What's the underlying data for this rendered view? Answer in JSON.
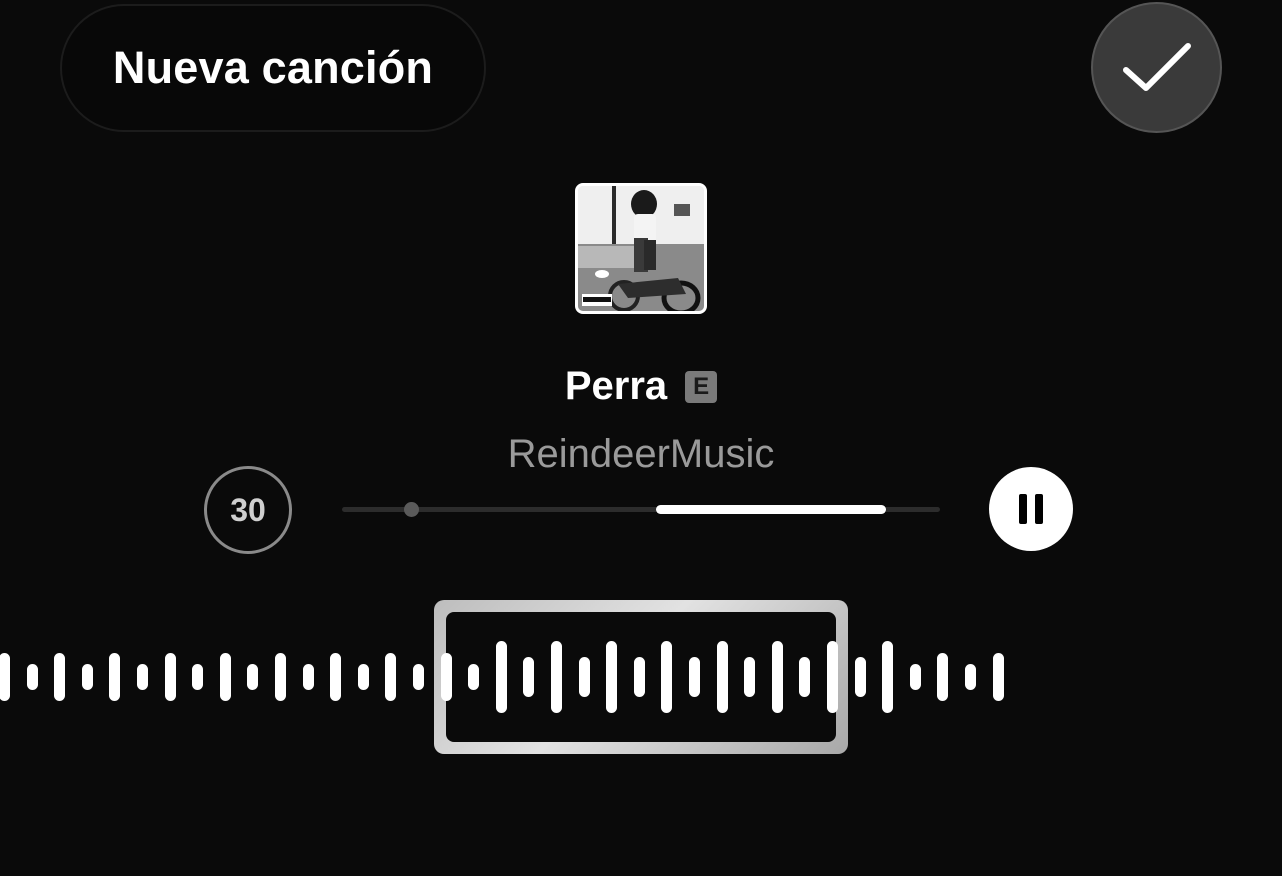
{
  "header": {
    "title_button_label": "Nueva canción",
    "confirm_icon": "checkmark-icon"
  },
  "track": {
    "artwork_icon": "album-cover",
    "title": "Perra",
    "explicit_label": "E",
    "artist": "ReindeerMusic"
  },
  "player": {
    "clip_length_label": "30",
    "playback_state_icon": "pause-icon",
    "selection_start_fraction": 0.525,
    "selection_end_fraction": 0.91,
    "marker_fraction": 0.115
  },
  "waveform": {
    "bar_heights": [
      48,
      26,
      48,
      26,
      48,
      26,
      48,
      26,
      48,
      26,
      48,
      26,
      48,
      26,
      48,
      26,
      48,
      26,
      72,
      40,
      72,
      40,
      72,
      40,
      72,
      40,
      72,
      40,
      72,
      40,
      72,
      40,
      72,
      26,
      48,
      26,
      48
    ],
    "selected_from_index": 16,
    "selected_to_index": 30
  },
  "colors": {
    "background": "#0a0a0a",
    "accent": "#ffffff",
    "muted_text": "#9a9a9a"
  }
}
